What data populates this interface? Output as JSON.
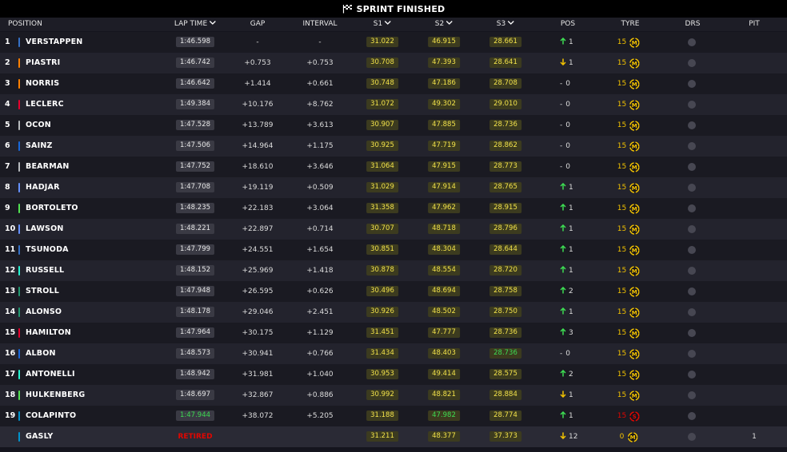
{
  "title": "SPRINT FINISHED",
  "columns": {
    "position": "POSITION",
    "lap_time": "LAP TIME",
    "gap": "GAP",
    "interval": "INTERVAL",
    "s1": "S1",
    "s2": "S2",
    "s3": "S3",
    "pos": "POS",
    "tyre": "TYRE",
    "drs": "DRS",
    "pit": "PIT"
  },
  "team_colors": {
    "red_bull": "#3671c6",
    "mclaren": "#ff8000",
    "ferrari": "#e8002d",
    "haas": "#b6babd",
    "williams": "#1868db",
    "racing_bulls": "#6692ff",
    "sauber": "#52e252",
    "mercedes": "#27f4d2",
    "aston_martin": "#229971",
    "alpine": "#0093cc"
  },
  "tyre_colors": {
    "medium": "#f2c200",
    "soft": "#e10600"
  },
  "rows": [
    {
      "pos": "1",
      "driver": "VERSTAPPEN",
      "team": "#3671c6",
      "lap": "1:46.598",
      "lap_best": false,
      "gap": "-",
      "interval": "-",
      "s1": "31.022",
      "s2": "46.915",
      "s3": "28.661",
      "s1g": false,
      "s2g": false,
      "s3g": false,
      "change": "up",
      "change_val": "1",
      "tyre_laps": "15",
      "tyre": "medium",
      "pit": ""
    },
    {
      "pos": "2",
      "driver": "PIASTRI",
      "team": "#ff8000",
      "lap": "1:46.742",
      "lap_best": false,
      "gap": "+0.753",
      "interval": "+0.753",
      "s1": "30.708",
      "s2": "47.393",
      "s3": "28.641",
      "s1g": false,
      "s2g": false,
      "s3g": false,
      "change": "down",
      "change_val": "1",
      "tyre_laps": "15",
      "tyre": "medium",
      "pit": ""
    },
    {
      "pos": "3",
      "driver": "NORRIS",
      "team": "#ff8000",
      "lap": "1:46.642",
      "lap_best": false,
      "gap": "+1.414",
      "interval": "+0.661",
      "s1": "30.748",
      "s2": "47.186",
      "s3": "28.708",
      "s1g": false,
      "s2g": false,
      "s3g": false,
      "change": "none",
      "change_val": "0",
      "tyre_laps": "15",
      "tyre": "medium",
      "pit": ""
    },
    {
      "pos": "4",
      "driver": "LECLERC",
      "team": "#e8002d",
      "lap": "1:49.384",
      "lap_best": false,
      "gap": "+10.176",
      "interval": "+8.762",
      "s1": "31.072",
      "s2": "49.302",
      "s3": "29.010",
      "s1g": false,
      "s2g": false,
      "s3g": false,
      "change": "none",
      "change_val": "0",
      "tyre_laps": "15",
      "tyre": "medium",
      "pit": ""
    },
    {
      "pos": "5",
      "driver": "OCON",
      "team": "#b6babd",
      "lap": "1:47.528",
      "lap_best": false,
      "gap": "+13.789",
      "interval": "+3.613",
      "s1": "30.907",
      "s2": "47.885",
      "s3": "28.736",
      "s1g": false,
      "s2g": false,
      "s3g": false,
      "change": "none",
      "change_val": "0",
      "tyre_laps": "15",
      "tyre": "medium",
      "pit": ""
    },
    {
      "pos": "6",
      "driver": "SAINZ",
      "team": "#1868db",
      "lap": "1:47.506",
      "lap_best": false,
      "gap": "+14.964",
      "interval": "+1.175",
      "s1": "30.925",
      "s2": "47.719",
      "s3": "28.862",
      "s1g": false,
      "s2g": false,
      "s3g": false,
      "change": "none",
      "change_val": "0",
      "tyre_laps": "15",
      "tyre": "medium",
      "pit": ""
    },
    {
      "pos": "7",
      "driver": "BEARMAN",
      "team": "#b6babd",
      "lap": "1:47.752",
      "lap_best": false,
      "gap": "+18.610",
      "interval": "+3.646",
      "s1": "31.064",
      "s2": "47.915",
      "s3": "28.773",
      "s1g": false,
      "s2g": false,
      "s3g": false,
      "change": "none",
      "change_val": "0",
      "tyre_laps": "15",
      "tyre": "medium",
      "pit": ""
    },
    {
      "pos": "8",
      "driver": "HADJAR",
      "team": "#6692ff",
      "lap": "1:47.708",
      "lap_best": false,
      "gap": "+19.119",
      "interval": "+0.509",
      "s1": "31.029",
      "s2": "47.914",
      "s3": "28.765",
      "s1g": false,
      "s2g": false,
      "s3g": false,
      "change": "up",
      "change_val": "1",
      "tyre_laps": "15",
      "tyre": "medium",
      "pit": ""
    },
    {
      "pos": "9",
      "driver": "BORTOLETO",
      "team": "#52e252",
      "lap": "1:48.235",
      "lap_best": false,
      "gap": "+22.183",
      "interval": "+3.064",
      "s1": "31.358",
      "s2": "47.962",
      "s3": "28.915",
      "s1g": false,
      "s2g": false,
      "s3g": false,
      "change": "up",
      "change_val": "1",
      "tyre_laps": "15",
      "tyre": "medium",
      "pit": ""
    },
    {
      "pos": "10",
      "driver": "LAWSON",
      "team": "#6692ff",
      "lap": "1:48.221",
      "lap_best": false,
      "gap": "+22.897",
      "interval": "+0.714",
      "s1": "30.707",
      "s2": "48.718",
      "s3": "28.796",
      "s1g": false,
      "s2g": false,
      "s3g": false,
      "change": "up",
      "change_val": "1",
      "tyre_laps": "15",
      "tyre": "medium",
      "pit": ""
    },
    {
      "pos": "11",
      "driver": "TSUNODA",
      "team": "#3671c6",
      "lap": "1:47.799",
      "lap_best": false,
      "gap": "+24.551",
      "interval": "+1.654",
      "s1": "30.851",
      "s2": "48.304",
      "s3": "28.644",
      "s1g": false,
      "s2g": false,
      "s3g": false,
      "change": "up",
      "change_val": "1",
      "tyre_laps": "15",
      "tyre": "medium",
      "pit": ""
    },
    {
      "pos": "12",
      "driver": "RUSSELL",
      "team": "#27f4d2",
      "lap": "1:48.152",
      "lap_best": false,
      "gap": "+25.969",
      "interval": "+1.418",
      "s1": "30.878",
      "s2": "48.554",
      "s3": "28.720",
      "s1g": false,
      "s2g": false,
      "s3g": false,
      "change": "up",
      "change_val": "1",
      "tyre_laps": "15",
      "tyre": "medium",
      "pit": ""
    },
    {
      "pos": "13",
      "driver": "STROLL",
      "team": "#229971",
      "lap": "1:47.948",
      "lap_best": false,
      "gap": "+26.595",
      "interval": "+0.626",
      "s1": "30.496",
      "s2": "48.694",
      "s3": "28.758",
      "s1g": false,
      "s2g": false,
      "s3g": false,
      "change": "up",
      "change_val": "2",
      "tyre_laps": "15",
      "tyre": "medium",
      "pit": ""
    },
    {
      "pos": "14",
      "driver": "ALONSO",
      "team": "#229971",
      "lap": "1:48.178",
      "lap_best": false,
      "gap": "+29.046",
      "interval": "+2.451",
      "s1": "30.926",
      "s2": "48.502",
      "s3": "28.750",
      "s1g": false,
      "s2g": false,
      "s3g": false,
      "change": "up",
      "change_val": "1",
      "tyre_laps": "15",
      "tyre": "medium",
      "pit": ""
    },
    {
      "pos": "15",
      "driver": "HAMILTON",
      "team": "#e8002d",
      "lap": "1:47.964",
      "lap_best": false,
      "gap": "+30.175",
      "interval": "+1.129",
      "s1": "31.451",
      "s2": "47.777",
      "s3": "28.736",
      "s1g": false,
      "s2g": false,
      "s3g": false,
      "change": "up",
      "change_val": "3",
      "tyre_laps": "15",
      "tyre": "medium",
      "pit": ""
    },
    {
      "pos": "16",
      "driver": "ALBON",
      "team": "#1868db",
      "lap": "1:48.573",
      "lap_best": false,
      "gap": "+30.941",
      "interval": "+0.766",
      "s1": "31.434",
      "s2": "48.403",
      "s3": "28.736",
      "s1g": false,
      "s2g": false,
      "s3g": true,
      "change": "none",
      "change_val": "0",
      "tyre_laps": "15",
      "tyre": "medium",
      "pit": ""
    },
    {
      "pos": "17",
      "driver": "ANTONELLI",
      "team": "#27f4d2",
      "lap": "1:48.942",
      "lap_best": false,
      "gap": "+31.981",
      "interval": "+1.040",
      "s1": "30.953",
      "s2": "49.414",
      "s3": "28.575",
      "s1g": false,
      "s2g": false,
      "s3g": false,
      "change": "up",
      "change_val": "2",
      "tyre_laps": "15",
      "tyre": "medium",
      "pit": ""
    },
    {
      "pos": "18",
      "driver": "HULKENBERG",
      "team": "#52e252",
      "lap": "1:48.697",
      "lap_best": false,
      "gap": "+32.867",
      "interval": "+0.886",
      "s1": "30.992",
      "s2": "48.821",
      "s3": "28.884",
      "s1g": false,
      "s2g": false,
      "s3g": false,
      "change": "down",
      "change_val": "1",
      "tyre_laps": "15",
      "tyre": "medium",
      "pit": ""
    },
    {
      "pos": "19",
      "driver": "COLAPINTO",
      "team": "#0093cc",
      "lap": "1:47.944",
      "lap_best": true,
      "gap": "+38.072",
      "interval": "+5.205",
      "s1": "31.188",
      "s2": "47.982",
      "s3": "28.774",
      "s1g": false,
      "s2g": true,
      "s3g": false,
      "change": "up",
      "change_val": "1",
      "tyre_laps": "15",
      "tyre": "soft",
      "pit": ""
    },
    {
      "pos": "",
      "driver": "GASLY",
      "team": "#0093cc",
      "lap": "RETIRED",
      "lap_best": false,
      "retired": true,
      "gap": "",
      "interval": "",
      "s1": "31.211",
      "s2": "48.377",
      "s3": "37.373",
      "s1g": false,
      "s2g": false,
      "s3g": false,
      "change": "down",
      "change_val": "12",
      "tyre_laps": "0",
      "tyre": "medium",
      "pit": "1"
    }
  ]
}
